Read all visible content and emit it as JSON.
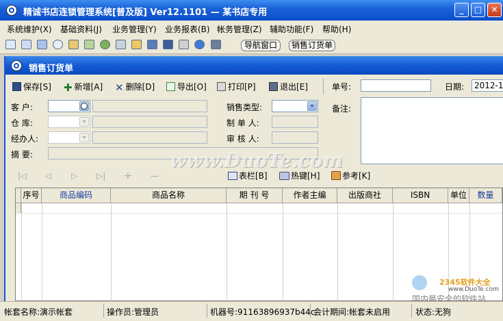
{
  "window": {
    "title": "精诚书店连锁管理系统[普及版] Ver12.1101 — 某书店专用",
    "min": "_",
    "max": "□",
    "close": "✕"
  },
  "menu": [
    "系统维护(X)",
    "基础资料(J)",
    "业务管理(Y)",
    "业务报表(B)",
    "帐务管理(Z)",
    "辅助功能(F)",
    "帮助(H)"
  ],
  "toolbar": {
    "icons": [
      "grid-icon",
      "list-icon",
      "window-icon",
      "search-icon",
      "report-icon",
      "arrow-icon",
      "people-icon",
      "transfer-icon",
      "folder-icon",
      "card-icon",
      "save-icon",
      "print-icon",
      "help-icon",
      "exit-icon"
    ],
    "nav_window": "导航窗口",
    "sales_order": "销售订货单"
  },
  "child": {
    "title": "销售订货单",
    "actions": {
      "save": "保存[S]",
      "new": "新增[A]",
      "delete": "删除[D]",
      "export": "导出[O]",
      "print": "打印[P]",
      "exit": "退出[E]"
    },
    "doc_no_label": "单号:",
    "doc_no_value": "",
    "date_label": "日期:",
    "date_value": "2012-1",
    "form": {
      "customer": "客  户:",
      "warehouse": "仓  库:",
      "handler": "经办人:",
      "summary": "摘  要:",
      "sales_type": "销售类型:",
      "creator": "制 单 人:",
      "auditor": "审 核 人:",
      "remark": "备注:"
    },
    "nav": [
      "|◁",
      "◁",
      "▷",
      "▷|",
      "✛",
      "—"
    ],
    "bottom_actions": {
      "columns": "表栏[B]",
      "hotkey": "热键[H]",
      "reference": "参考[K]"
    },
    "grid_columns": [
      "序号",
      "商品编码",
      "商品名称",
      "期 刊 号",
      "作者主编",
      "出版商社",
      "ISBN",
      "单位",
      "数量"
    ]
  },
  "status": {
    "account": "帐套名称:演示帐套",
    "operator": "操作员:管理员",
    "machine": "机器号:91163896937b44c",
    "period": "会计期间:帐套未启用",
    "state": "状态:无狗"
  },
  "watermark": {
    "main": "www.DuoTe.com",
    "corner_top": "2345软件大全",
    "corner_url": "www.DuoTe.com",
    "corner_bottom": "国内最安全的软件站"
  },
  "colors": {
    "titlebar": "#0b4ec9",
    "accent_blue": "#1b3d9e"
  }
}
